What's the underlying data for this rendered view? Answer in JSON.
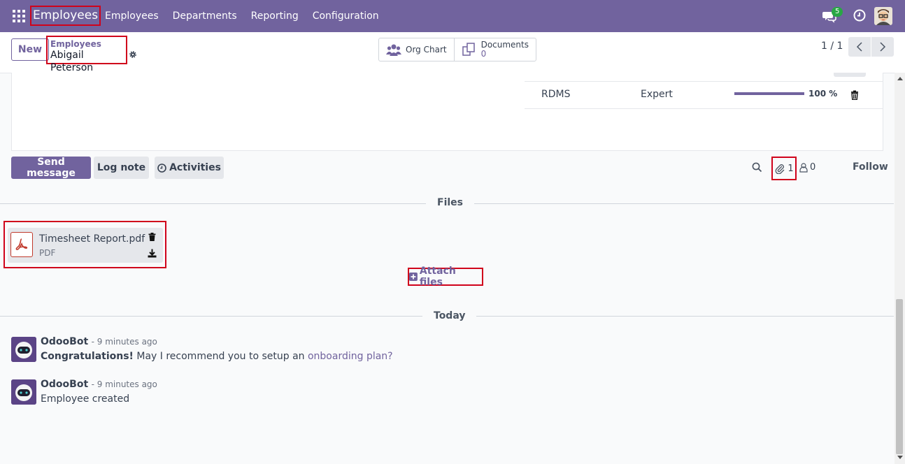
{
  "navbar": {
    "app_name": "Employees",
    "menu": [
      "Employees",
      "Departments",
      "Reporting",
      "Configuration"
    ],
    "chat_badge": "5",
    "icons": [
      "apps-grid-icon",
      "chat-icon",
      "clock-icon",
      "user-avatar"
    ]
  },
  "control_panel": {
    "new_label": "New",
    "breadcrumb_parent": "Employees",
    "breadcrumb_current": "Abigail Peterson",
    "org_chart_label": "Org Chart",
    "documents_label": "Documents",
    "documents_count": "0",
    "pager": "1 / 1"
  },
  "skill": {
    "name": "RDMS",
    "level": "Expert",
    "progress": 1.0,
    "percent": "100 %"
  },
  "chatter": {
    "send_message": "Send message",
    "log_note": "Log note",
    "activities": "Activities",
    "attachment_count": "1",
    "follower_count": "0",
    "follow": "Follow",
    "files_heading": "Files",
    "attach_files": "Attach files",
    "today_heading": "Today"
  },
  "attachment": {
    "name": "Timesheet Report.pdf",
    "type": "PDF"
  },
  "messages": [
    {
      "author": "OdooBot",
      "date": "- 9 minutes ago",
      "body_bold": "Congratulations!",
      "body_text": " May I recommend you to setup an ",
      "body_link": "onboarding plan?"
    },
    {
      "author": "OdooBot",
      "date": "- 9 minutes ago",
      "body_text": "Employee created"
    }
  ],
  "colors": {
    "brand": "#71639e",
    "highlight": "#d0021b",
    "badge": "#28a745"
  }
}
